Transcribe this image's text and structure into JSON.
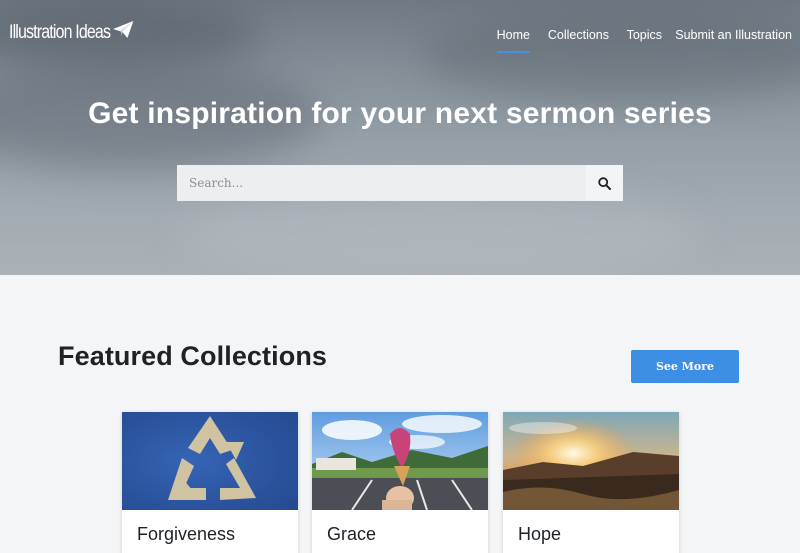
{
  "header": {
    "logo_text": "Illustration Ideas",
    "nav": [
      {
        "label": "Home",
        "active": true
      },
      {
        "label": "Collections",
        "active": false
      },
      {
        "label": "Topics",
        "active": false
      },
      {
        "label": "Submit an Illustration",
        "active": false
      }
    ]
  },
  "hero": {
    "title": "Get inspiration for your next sermon series",
    "search_placeholder": "Search...",
    "search_value": ""
  },
  "featured": {
    "title": "Featured Collections",
    "see_more_label": "See More",
    "cards": [
      {
        "title": "Forgiveness",
        "image": "recycle-symbol-image"
      },
      {
        "title": "Grace",
        "image": "ice-cream-cone-image"
      },
      {
        "title": "Hope",
        "image": "sunset-hills-image"
      }
    ]
  },
  "colors": {
    "accent": "#3d8fe6",
    "nav_underline": "#4a90e2",
    "page_background": "#f4f5f7",
    "heading": "#1e2226"
  },
  "icons": {
    "logo": "paper-plane-icon",
    "search": "search-icon"
  }
}
